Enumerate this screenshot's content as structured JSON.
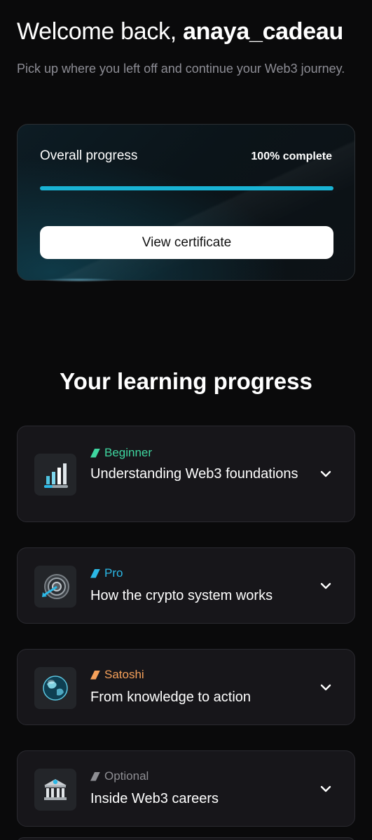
{
  "header": {
    "welcome_prefix": "Welcome back,",
    "username": "anaya_cadeau",
    "subtitle": "Pick up where you left off and continue your Web3 journey."
  },
  "overall_progress": {
    "label": "Overall progress",
    "percent_text": "100% complete",
    "percent": 100,
    "button_label": "View certificate",
    "bar_color": "#19b3d4"
  },
  "learning": {
    "title": "Your learning progress",
    "courses": [
      {
        "tier": "Beginner",
        "tier_color": "#3fd6a0",
        "title": "Understanding Web3 foundations",
        "icon": "bar-chart-icon"
      },
      {
        "tier": "Pro",
        "tier_color": "#2bb8e6",
        "title": "How the crypto system works",
        "icon": "target-icon"
      },
      {
        "tier": "Satoshi",
        "tier_color": "#f5a05a",
        "title": "From knowledge to action",
        "icon": "globe-icon"
      },
      {
        "tier": "Optional",
        "tier_color": "#8e8e93",
        "title": "Inside Web3 careers",
        "icon": "bank-icon"
      }
    ]
  }
}
